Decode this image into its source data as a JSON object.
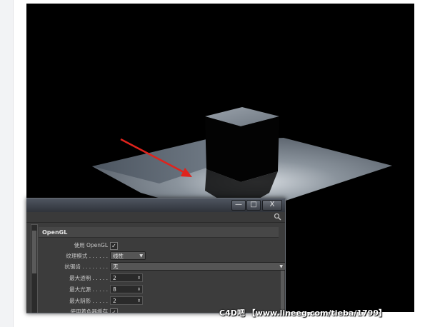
{
  "dialog": {
    "section_title": "OpenGL",
    "title_buttons": [
      "—",
      "□",
      "X"
    ],
    "search_icon": "search-icon",
    "rows": [
      {
        "label": "使用 OpenGL",
        "type": "checkbox",
        "value": "✓"
      },
      {
        "label": "纹理模式 . . . . . .",
        "type": "combo",
        "value": "线性"
      },
      {
        "label": "抗锯齿 . . . . . . . .",
        "type": "combo",
        "value": "无"
      },
      {
        "label": "最大透明 . . . . .",
        "type": "number",
        "value": "2"
      },
      {
        "label": "最大光源 . . . . .",
        "type": "number",
        "value": "8"
      },
      {
        "label": "最大阴影 . . . . .",
        "type": "number",
        "value": "2"
      },
      {
        "label": "使用着色器缓存",
        "type": "checkbox",
        "value": "✓"
      }
    ]
  },
  "watermark": "C4D吧 【www.lineeg.com/tieba/1799】",
  "colors": {
    "viewport_bg": "#000000",
    "arrow": "#e0231c",
    "dialog_bg": "#3c3c3c"
  }
}
